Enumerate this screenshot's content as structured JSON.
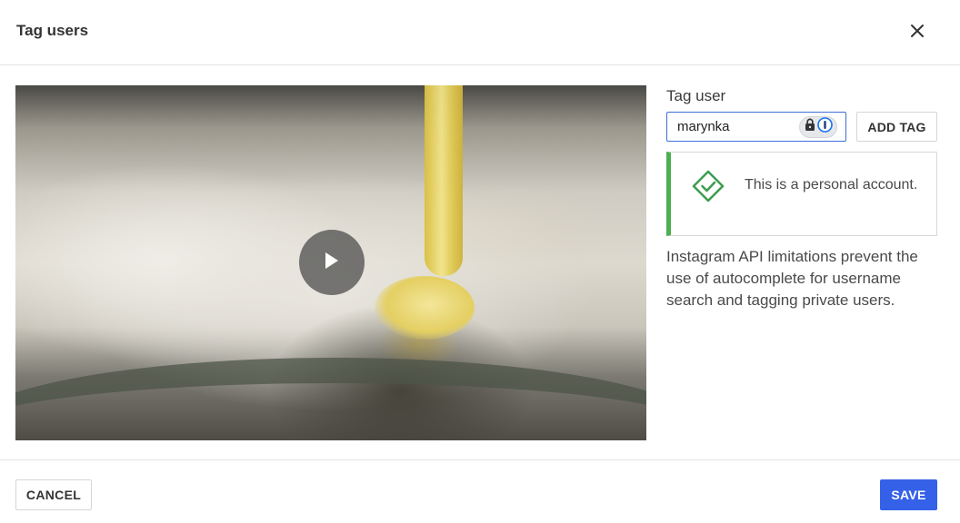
{
  "dialog": {
    "title": "Tag users",
    "close_icon": "close-icon"
  },
  "media": {
    "type": "video",
    "play_icon": "play-icon"
  },
  "tag_form": {
    "label": "Tag user",
    "input_value": "marynka",
    "password_manager_icons": [
      "lock-icon",
      "onepassword-icon"
    ],
    "add_button_label": "ADD TAG"
  },
  "notice": {
    "icon": "check-diamond-icon",
    "text": "This is a personal account.",
    "accent_color": "#4caf50"
  },
  "help_text": "Instagram API limitations prevent the use of autocomplete for username search and tagging private users.",
  "footer": {
    "cancel_label": "CANCEL",
    "save_label": "SAVE"
  },
  "colors": {
    "primary": "#3461e8",
    "input_focus_border": "#3d6fd8"
  }
}
